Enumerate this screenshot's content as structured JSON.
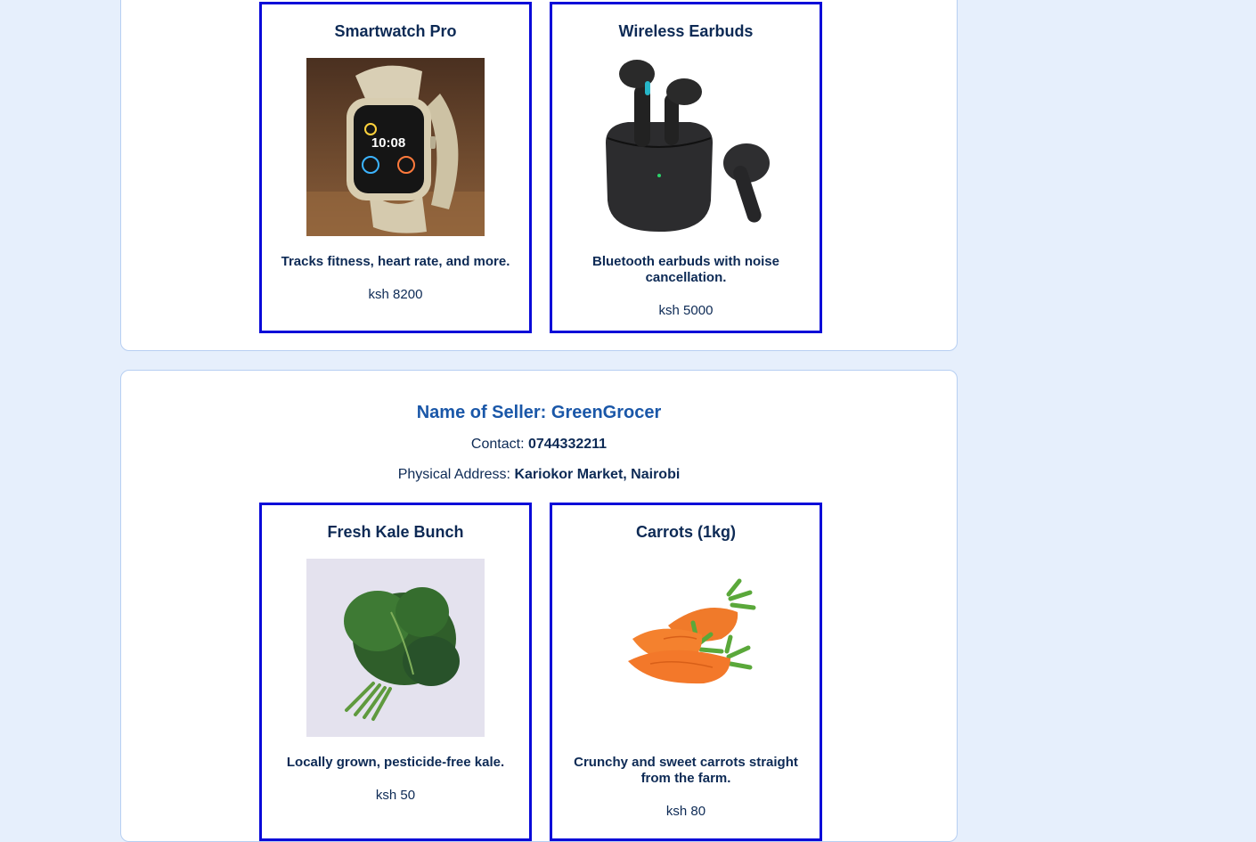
{
  "sellers": [
    {
      "products": [
        {
          "title": "Smartwatch Pro",
          "image": "smartwatch-image",
          "description": "Tracks fitness, heart rate, and more.",
          "price": "ksh 8200"
        },
        {
          "title": "Wireless Earbuds",
          "image": "earbuds-image",
          "description": "Bluetooth earbuds with noise cancellation.",
          "price": "ksh 5000"
        }
      ]
    },
    {
      "name": "Name of Seller: GreenGrocer",
      "contact_label": "Contact: ",
      "contact_value": "0744332211",
      "address_label": "Physical Address: ",
      "address_value": "Kariokor Market, Nairobi",
      "products": [
        {
          "title": "Fresh Kale Bunch",
          "image": "kale-image",
          "description": "Locally grown, pesticide-free kale.",
          "price": "ksh 50"
        },
        {
          "title": "Carrots (1kg)",
          "image": "carrots-image",
          "description": "Crunchy and sweet carrots straight from the farm.",
          "price": "ksh 80"
        }
      ]
    }
  ],
  "colors": {
    "page_bg": "#e6effc",
    "card_border": "#0a0ad8",
    "seller_name": "#1a57a8",
    "text": "#0d2a55"
  }
}
